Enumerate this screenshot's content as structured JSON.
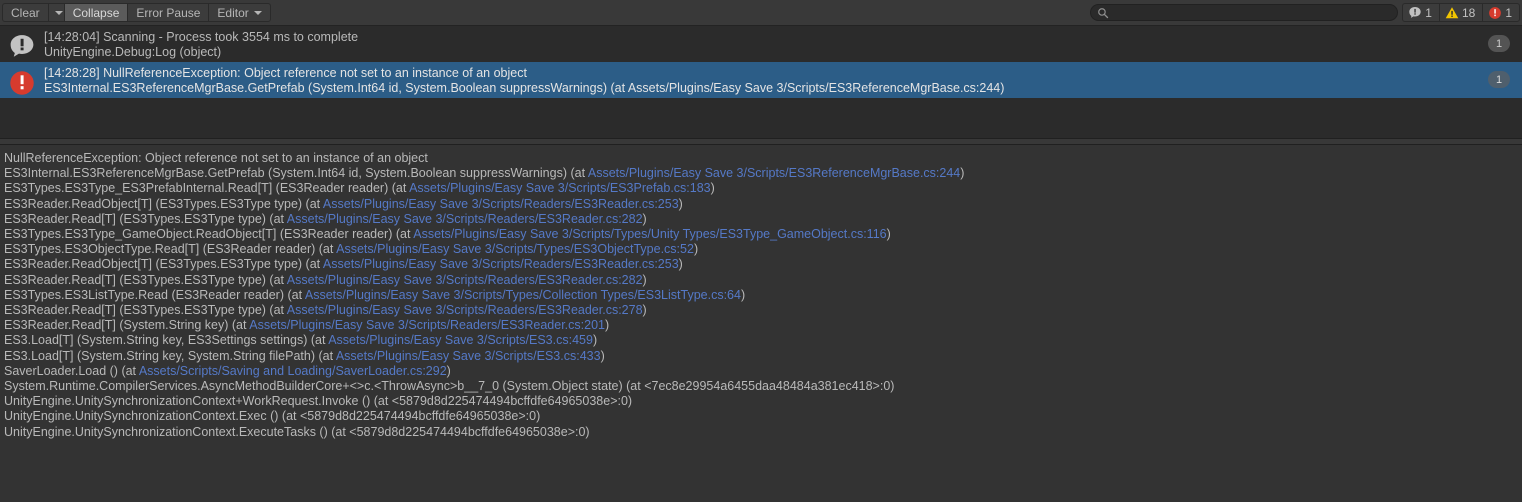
{
  "toolbar": {
    "clear_label": "Clear",
    "clear_dropdown_icon": "chevron-down-icon",
    "collapse_label": "Collapse",
    "error_pause_label": "Error Pause",
    "editor_label": "Editor",
    "editor_dropdown_icon": "chevron-down-icon",
    "search": {
      "value": "",
      "placeholder": "",
      "icon": "search-icon"
    },
    "counters": [
      {
        "name": "info-counter",
        "icon": "info-icon",
        "count": "1",
        "color": "#c0c0c0"
      },
      {
        "name": "warning-counter",
        "icon": "warning-icon",
        "count": "18",
        "color": "#f2c500"
      },
      {
        "name": "error-counter",
        "icon": "error-icon",
        "count": "1",
        "color": "#d63b2e"
      }
    ]
  },
  "log_list": {
    "entries": [
      {
        "severity": "info",
        "icon": "info-icon",
        "line1": "[14:28:04] Scanning - Process took 3554 ms to complete",
        "line2": "UnityEngine.Debug:Log (object)",
        "count": "1",
        "selected": false
      },
      {
        "severity": "error",
        "icon": "error-icon",
        "line1": "[14:28:28] NullReferenceException: Object reference not set to an instance of an object",
        "line2": "ES3Internal.ES3ReferenceMgrBase.GetPrefab (System.Int64 id, System.Boolean suppressWarnings) (at Assets/Plugins/Easy Save 3/Scripts/ES3ReferenceMgrBase.cs:244)",
        "count": "1",
        "selected": true
      }
    ]
  },
  "detail": {
    "lines": [
      [
        {
          "t": "NullReferenceException: Object reference not set to an instance of an object",
          "link": false
        }
      ],
      [
        {
          "t": "ES3Internal.ES3ReferenceMgrBase.GetPrefab (System.Int64 id, System.Boolean suppressWarnings) (at ",
          "link": false
        },
        {
          "t": "Assets/Plugins/Easy Save 3/Scripts/ES3ReferenceMgrBase.cs:244",
          "link": true
        },
        {
          "t": ")",
          "link": false
        }
      ],
      [
        {
          "t": "ES3Types.ES3Type_ES3PrefabInternal.Read[T] (ES3Reader reader) (at ",
          "link": false
        },
        {
          "t": "Assets/Plugins/Easy Save 3/Scripts/ES3Prefab.cs:183",
          "link": true
        },
        {
          "t": ")",
          "link": false
        }
      ],
      [
        {
          "t": "ES3Reader.ReadObject[T] (ES3Types.ES3Type type) (at ",
          "link": false
        },
        {
          "t": "Assets/Plugins/Easy Save 3/Scripts/Readers/ES3Reader.cs:253",
          "link": true
        },
        {
          "t": ")",
          "link": false
        }
      ],
      [
        {
          "t": "ES3Reader.Read[T] (ES3Types.ES3Type type) (at ",
          "link": false
        },
        {
          "t": "Assets/Plugins/Easy Save 3/Scripts/Readers/ES3Reader.cs:282",
          "link": true
        },
        {
          "t": ")",
          "link": false
        }
      ],
      [
        {
          "t": "ES3Types.ES3Type_GameObject.ReadObject[T] (ES3Reader reader) (at ",
          "link": false
        },
        {
          "t": "Assets/Plugins/Easy Save 3/Scripts/Types/Unity Types/ES3Type_GameObject.cs:116",
          "link": true
        },
        {
          "t": ")",
          "link": false
        }
      ],
      [
        {
          "t": "ES3Types.ES3ObjectType.Read[T] (ES3Reader reader) (at ",
          "link": false
        },
        {
          "t": "Assets/Plugins/Easy Save 3/Scripts/Types/ES3ObjectType.cs:52",
          "link": true
        },
        {
          "t": ")",
          "link": false
        }
      ],
      [
        {
          "t": "ES3Reader.ReadObject[T] (ES3Types.ES3Type type) (at ",
          "link": false
        },
        {
          "t": "Assets/Plugins/Easy Save 3/Scripts/Readers/ES3Reader.cs:253",
          "link": true
        },
        {
          "t": ")",
          "link": false
        }
      ],
      [
        {
          "t": "ES3Reader.Read[T] (ES3Types.ES3Type type) (at ",
          "link": false
        },
        {
          "t": "Assets/Plugins/Easy Save 3/Scripts/Readers/ES3Reader.cs:282",
          "link": true
        },
        {
          "t": ")",
          "link": false
        }
      ],
      [
        {
          "t": "ES3Types.ES3ListType.Read (ES3Reader reader) (at ",
          "link": false
        },
        {
          "t": "Assets/Plugins/Easy Save 3/Scripts/Types/Collection Types/ES3ListType.cs:64",
          "link": true
        },
        {
          "t": ")",
          "link": false
        }
      ],
      [
        {
          "t": "ES3Reader.Read[T] (ES3Types.ES3Type type) (at ",
          "link": false
        },
        {
          "t": "Assets/Plugins/Easy Save 3/Scripts/Readers/ES3Reader.cs:278",
          "link": true
        },
        {
          "t": ")",
          "link": false
        }
      ],
      [
        {
          "t": "ES3Reader.Read[T] (System.String key) (at ",
          "link": false
        },
        {
          "t": "Assets/Plugins/Easy Save 3/Scripts/Readers/ES3Reader.cs:201",
          "link": true
        },
        {
          "t": ")",
          "link": false
        }
      ],
      [
        {
          "t": "ES3.Load[T] (System.String key, ES3Settings settings) (at ",
          "link": false
        },
        {
          "t": "Assets/Plugins/Easy Save 3/Scripts/ES3.cs:459",
          "link": true
        },
        {
          "t": ")",
          "link": false
        }
      ],
      [
        {
          "t": "ES3.Load[T] (System.String key, System.String filePath) (at ",
          "link": false
        },
        {
          "t": "Assets/Plugins/Easy Save 3/Scripts/ES3.cs:433",
          "link": true
        },
        {
          "t": ")",
          "link": false
        }
      ],
      [
        {
          "t": "SaverLoader.Load () (at ",
          "link": false
        },
        {
          "t": "Assets/Scripts/Saving and Loading/SaverLoader.cs:292",
          "link": true
        },
        {
          "t": ")",
          "link": false
        }
      ],
      [
        {
          "t": "System.Runtime.CompilerServices.AsyncMethodBuilderCore+<>c.<ThrowAsync>b__7_0 (System.Object state) (at <7ec8e29954a6455daa48484a381ec418>:0)",
          "link": false
        }
      ],
      [
        {
          "t": "UnityEngine.UnitySynchronizationContext+WorkRequest.Invoke () (at <5879d8d225474494bcffdfe64965038e>:0)",
          "link": false
        }
      ],
      [
        {
          "t": "UnityEngine.UnitySynchronizationContext.Exec () (at <5879d8d225474494bcffdfe64965038e>:0)",
          "link": false
        }
      ],
      [
        {
          "t": "UnityEngine.UnitySynchronizationContext.ExecuteTasks () (at <5879d8d225474494bcffdfe64965038e>:0)",
          "link": false
        }
      ]
    ]
  },
  "colors": {
    "window_bg": "#383838",
    "list_bg": "#2b2b2b",
    "detail_bg": "#333333",
    "selection": "#2c5d87",
    "link": "#5579c7",
    "text": "#b9b9b9",
    "error": "#d63b2e",
    "warning": "#f2c500",
    "info": "#c0c0c0"
  }
}
